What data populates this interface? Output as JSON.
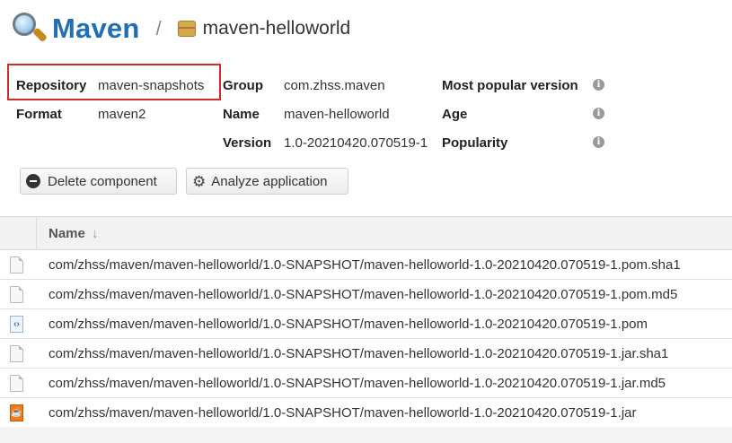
{
  "header": {
    "title": "Maven",
    "separator": "/",
    "component_name": "maven-helloworld"
  },
  "metadata": {
    "repository_label": "Repository",
    "repository_value": "maven-snapshots",
    "format_label": "Format",
    "format_value": "maven2",
    "group_label": "Group",
    "group_value": "com.zhss.maven",
    "name_label": "Name",
    "name_value": "maven-helloworld",
    "version_label": "Version",
    "version_value": "1.0-20210420.070519-1",
    "most_popular_label": "Most popular version",
    "age_label": "Age",
    "popularity_label": "Popularity",
    "info_glyph": "i"
  },
  "toolbar": {
    "delete_label": "Delete component",
    "analyze_label": "Analyze application"
  },
  "table": {
    "name_header": "Name",
    "sort_glyph": "↓",
    "rows": [
      {
        "icon": "text-file-icon",
        "name": "com/zhss/maven/maven-helloworld/1.0-SNAPSHOT/maven-helloworld-1.0-20210420.070519-1.pom.sha1"
      },
      {
        "icon": "text-file-icon",
        "name": "com/zhss/maven/maven-helloworld/1.0-SNAPSHOT/maven-helloworld-1.0-20210420.070519-1.pom.md5"
      },
      {
        "icon": "xml-file-icon",
        "name": "com/zhss/maven/maven-helloworld/1.0-SNAPSHOT/maven-helloworld-1.0-20210420.070519-1.pom"
      },
      {
        "icon": "text-file-icon",
        "name": "com/zhss/maven/maven-helloworld/1.0-SNAPSHOT/maven-helloworld-1.0-20210420.070519-1.jar.sha1"
      },
      {
        "icon": "text-file-icon",
        "name": "com/zhss/maven/maven-helloworld/1.0-SNAPSHOT/maven-helloworld-1.0-20210420.070519-1.jar.md5"
      },
      {
        "icon": "jar-file-icon",
        "name": "com/zhss/maven/maven-helloworld/1.0-SNAPSHOT/maven-helloworld-1.0-20210420.070519-1.jar"
      }
    ]
  },
  "colors": {
    "title": "#1f6fb5",
    "highlight_border": "#d42a2a",
    "jar_icon": "#f07a1a"
  }
}
